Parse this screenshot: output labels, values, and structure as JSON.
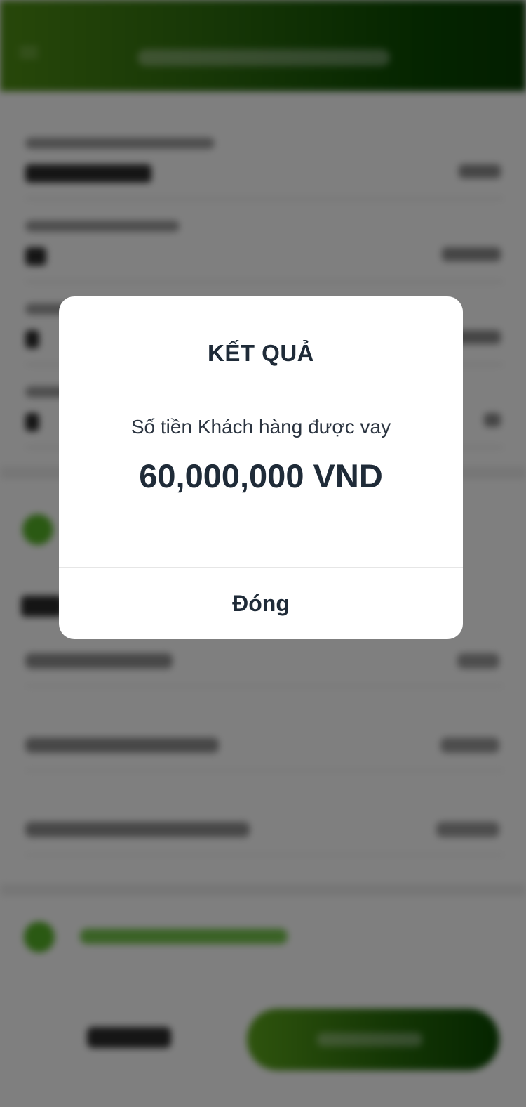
{
  "dialog": {
    "title": "KẾT QUẢ",
    "message": "Số tiền Khách hàng được vay",
    "amount": "60,000,000 VND",
    "close_label": "Đóng"
  },
  "colors": {
    "brand_green_light": "#4f8f14",
    "brand_green_dark": "#063d00",
    "text_dark": "#1f2b38"
  }
}
